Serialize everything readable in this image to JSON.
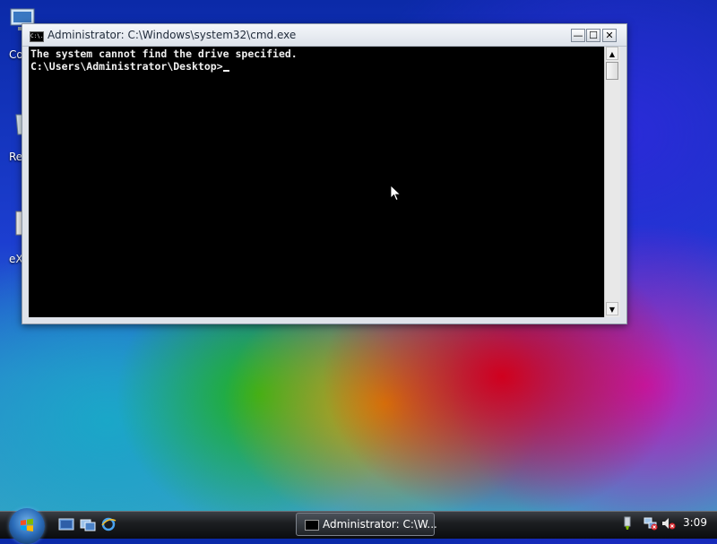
{
  "desktop": {
    "icons": [
      {
        "label": "Co"
      },
      {
        "label": "Re"
      },
      {
        "label": "eX"
      }
    ]
  },
  "window": {
    "title": "Administrator: C:\\Windows\\system32\\cmd.exe",
    "icon_text": "C:\\.",
    "console_lines": [
      "The system cannot find the drive specified.",
      "",
      "C:\\Users\\Administrator\\Desktop>"
    ],
    "minimize": "—",
    "maximize": "☐",
    "close": "✕"
  },
  "taskbar": {
    "task_button_label": "Administrator: C:\\W...",
    "clock": "3:09"
  }
}
